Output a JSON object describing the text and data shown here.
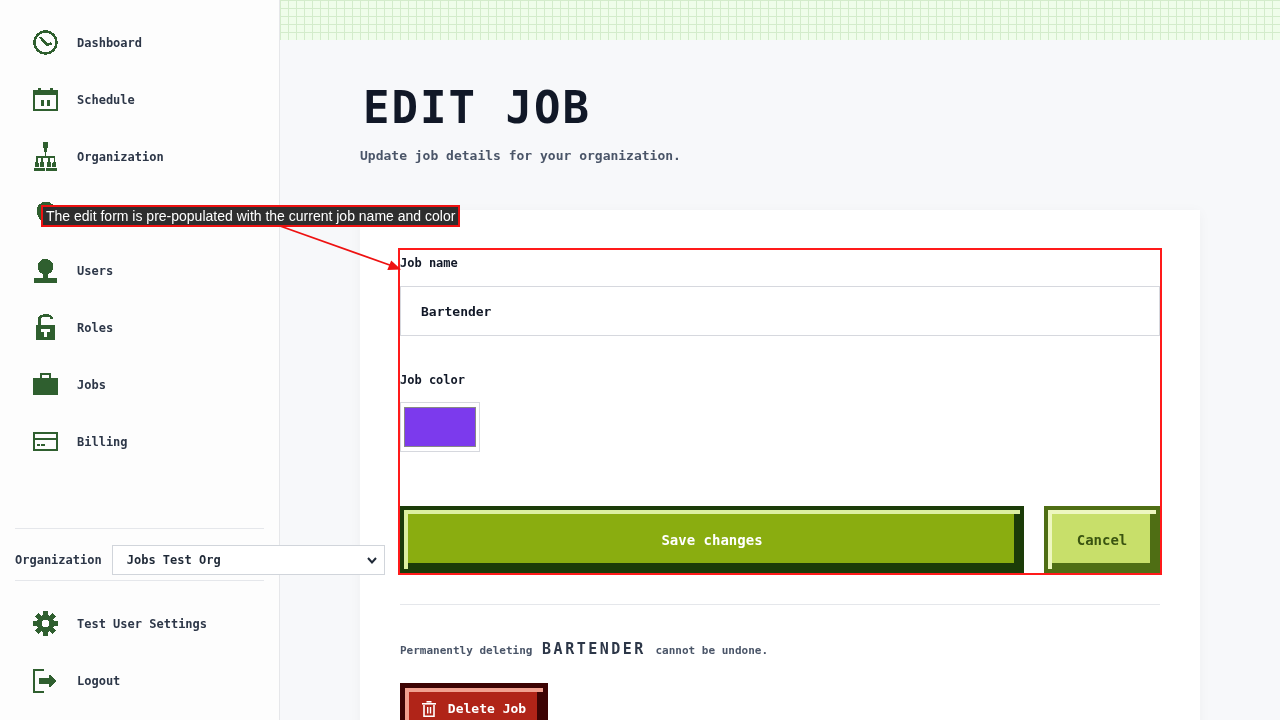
{
  "sidebar": {
    "nav_items": [
      {
        "label": "Dashboard",
        "selected": false
      },
      {
        "label": "Schedule",
        "selected": false
      },
      {
        "label": "Organization",
        "selected": false
      },
      {
        "selected": false
      },
      {
        "label": "Users",
        "selected": false
      },
      {
        "label": "Roles",
        "selected": false
      },
      {
        "label": "Jobs",
        "selected": false
      },
      {
        "label": "Billing",
        "selected": false
      }
    ],
    "organization": {
      "label": "Organization",
      "value": "Jobs Test Org"
    },
    "footer_items": [
      {
        "label": "Test User Settings"
      },
      {
        "label": "Logout"
      }
    ]
  },
  "page": {
    "title": "EDIT JOB",
    "subtitle": "Update job details for your organization."
  },
  "form": {
    "name_field": {
      "label": "Job name",
      "value": "Bartender"
    },
    "color_field": {
      "label": "Job color",
      "color": "#7c3aed"
    },
    "save_button": "Save changes",
    "cancel_button": "Cancel"
  },
  "danger_zone": {
    "warning": "Permanently deleting **BARTENDER** cannot be undone.",
    "delete_button": "Delete Job"
  },
  "annotation": {
    "text": "The edit form is pre-populated with the current job name and color"
  }
}
